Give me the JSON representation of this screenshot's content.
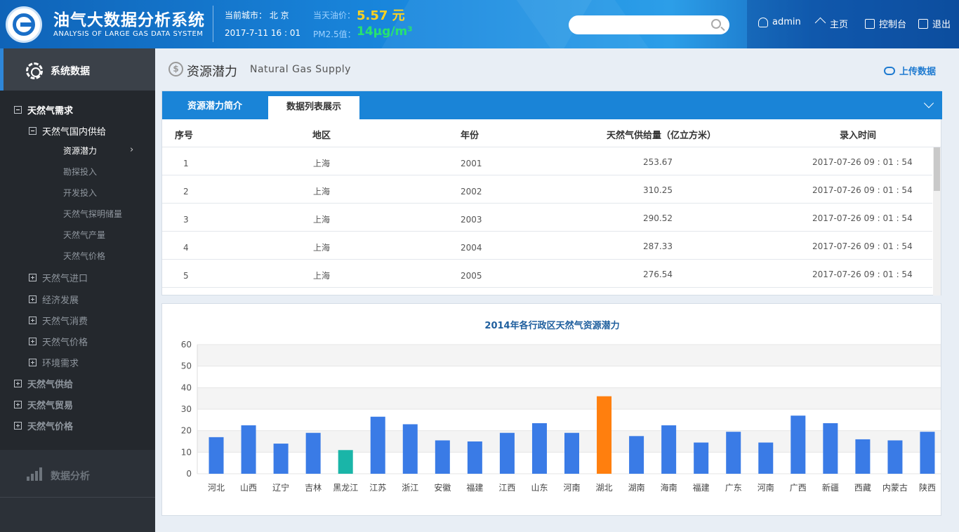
{
  "header": {
    "title": "油气大数据分析系统",
    "subtitle": "ANALYSIS OF LARGE GAS DATA SYSTEM",
    "city_label": "当前城市： 北 京",
    "datetime": "2017-7-11  16 : 01",
    "oil_label": "当天油价：",
    "oil_value": "5.57 元",
    "pm_label": "PM2.5值：",
    "pm_value": "14μg/m³",
    "search_placeholder": "",
    "nav": {
      "user": "admin",
      "home": "主页",
      "console": "控制台",
      "logout": "退出"
    }
  },
  "sidebar": {
    "header": "系统数据",
    "tree": {
      "demand": "天然气需求",
      "domestic_supply": "天然气国内供给",
      "leaves": [
        "资源潜力",
        "勘探投入",
        "开发投入",
        "天然气探明储量",
        "天然气产量",
        "天然气价格"
      ],
      "sub_collapsed": [
        "天然气进口",
        "经济发展",
        "天然气消费",
        "天然气价格",
        "环境需求"
      ],
      "top_collapsed": [
        "天然气供给",
        "天然气贸易",
        "天然气价格"
      ]
    },
    "analysis": "数据分析"
  },
  "content": {
    "title": "资源潜力",
    "subtitle": "Natural Gas Supply",
    "upload": "上传数据",
    "tabs": [
      "资源潜力简介",
      "数据列表展示"
    ],
    "table": {
      "headers": [
        "序号",
        "地区",
        "年份",
        "天然气供给量（亿立方米）",
        "录入时间"
      ],
      "rows": [
        [
          "1",
          "上海",
          "2001",
          "253.67",
          "2017-07-26   09 : 01 : 54"
        ],
        [
          "2",
          "上海",
          "2002",
          "310.25",
          "2017-07-26   09 : 01 : 54"
        ],
        [
          "3",
          "上海",
          "2003",
          "290.52",
          "2017-07-26   09 : 01 : 54"
        ],
        [
          "4",
          "上海",
          "2004",
          "287.33",
          "2017-07-26   09 : 01 : 54"
        ],
        [
          "5",
          "上海",
          "2005",
          "276.54",
          "2017-07-26   09 : 01 : 54"
        ]
      ]
    }
  },
  "chart_data": {
    "type": "bar",
    "title": "2014年各行政区天然气资源潜力",
    "xlabel": "",
    "ylabel": "",
    "ylim": [
      0,
      60
    ],
    "yticks": [
      0,
      10,
      20,
      30,
      40,
      50,
      60
    ],
    "grid": true,
    "categories": [
      "河北",
      "山西",
      "辽宁",
      "吉林",
      "黑龙江",
      "江苏",
      "浙江",
      "安徽",
      "福建",
      "江西",
      "山东",
      "河南",
      "湖北",
      "湖南",
      "海南",
      "福建",
      "广东",
      "河南",
      "广西",
      "新疆",
      "西藏",
      "内蒙古",
      "陕西"
    ],
    "values": [
      17,
      22.5,
      14,
      19,
      11,
      26.5,
      23,
      15.5,
      15,
      19,
      23.5,
      19,
      36,
      17.5,
      22.5,
      14.5,
      19.5,
      14.5,
      27,
      23.5,
      16,
      15.5,
      19.5
    ],
    "colors": {
      "default": "#3a7be6",
      "highlight_max": "#ff7f0e",
      "highlight_min": "#1ab5a8"
    },
    "highlight_index_max": 12,
    "highlight_index_min": 4
  }
}
